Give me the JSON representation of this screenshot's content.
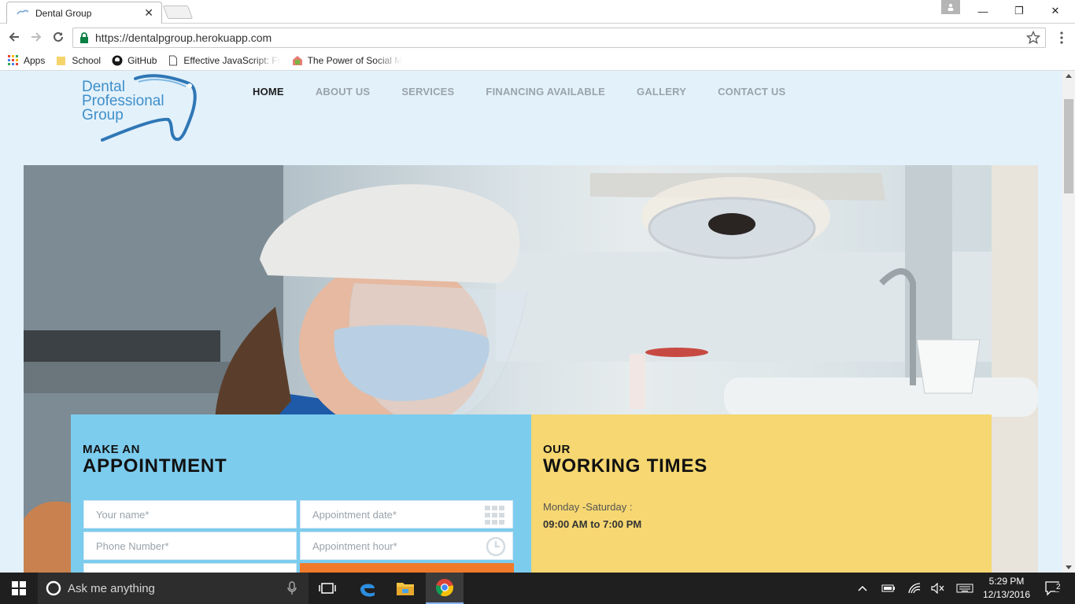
{
  "browser": {
    "tab_title": "Dental Group",
    "tab_close": "✕",
    "url": "https://dentalpgroup.herokuapp.com",
    "window_controls": {
      "minimize": "—",
      "restore": "❐",
      "close": "✕"
    },
    "bookmarks": [
      {
        "label": "Apps",
        "icon": "apps-grid-icon"
      },
      {
        "label": "School",
        "icon": "folder-icon"
      },
      {
        "label": "GitHub",
        "icon": "github-icon"
      },
      {
        "label": "Effective JavaScript: Fr",
        "icon": "page-icon"
      },
      {
        "label": "The Power of Social M",
        "icon": "social-icon"
      }
    ]
  },
  "site": {
    "logo": {
      "line1": "Dental",
      "line2": "Professional",
      "line3": "Group"
    },
    "nav": [
      {
        "label": "HOME",
        "active": true
      },
      {
        "label": "ABOUT US",
        "active": false
      },
      {
        "label": "SERVICES",
        "active": false
      },
      {
        "label": "FINANCING AVAILABLE",
        "active": false
      },
      {
        "label": "GALLERY",
        "active": false
      },
      {
        "label": "CONTACT US",
        "active": false
      }
    ],
    "appointment": {
      "heading_small": "MAKE AN",
      "heading_large": "APPOINTMENT",
      "name_placeholder": "Your name*",
      "date_placeholder": "Appointment date*",
      "phone_placeholder": "Phone Number*",
      "hour_placeholder": "Appointment hour*"
    },
    "hours": {
      "heading_small": "OUR",
      "heading_large": "WORKING TIMES",
      "days": "Monday -Saturday :",
      "time": "09:00 AM to 7:00 PM"
    },
    "colors": {
      "page_bg": "#e3f1fb",
      "appointment_panel": "#7cccee",
      "hours_panel": "#f6d771",
      "submit_button": "#f07a2a",
      "logo_blue": "#3f8fc9",
      "nav_active": "#1d1d1d",
      "nav_inactive": "#9aa3aa"
    }
  },
  "taskbar": {
    "search_placeholder": "Ask me anything",
    "time": "5:29 PM",
    "date": "12/13/2016",
    "notification_count": "2"
  }
}
